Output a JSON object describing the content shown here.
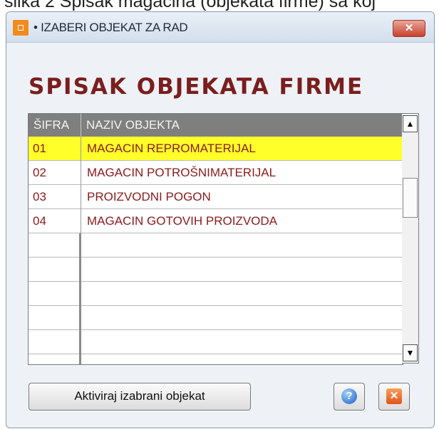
{
  "caption": "slika 2 Spisak magacina (objekata firme) sa koj",
  "window": {
    "title": "• IZABERI OBJEKAT ZA RAD",
    "close_label": "✕"
  },
  "heading": "SPISAK OBJEKATA FIRME",
  "grid": {
    "columns": [
      "ŠIFRA",
      "NAZIV OBJEKTA"
    ],
    "rows": [
      {
        "code": "01",
        "name": "MAGACIN REPROMATERIJAL",
        "selected": true
      },
      {
        "code": "02",
        "name": "MAGACIN POTROŠNIMATERIJAL",
        "selected": false
      },
      {
        "code": "03",
        "name": "PROIZVODNI POGON",
        "selected": false
      },
      {
        "code": "04",
        "name": "MAGACIN GOTOVIH PROIZVODA",
        "selected": false
      }
    ]
  },
  "scrollbar": {
    "up": "▲",
    "down": "▼"
  },
  "buttons": {
    "activate": "Aktiviraj izabrani objekat",
    "help_glyph": "?",
    "exit_glyph": "✕"
  },
  "colors": {
    "selection": "#ffff2a",
    "row_text": "#8b1a1a",
    "heading": "#7a1e1e",
    "header_bg": "#7f7f7f"
  }
}
